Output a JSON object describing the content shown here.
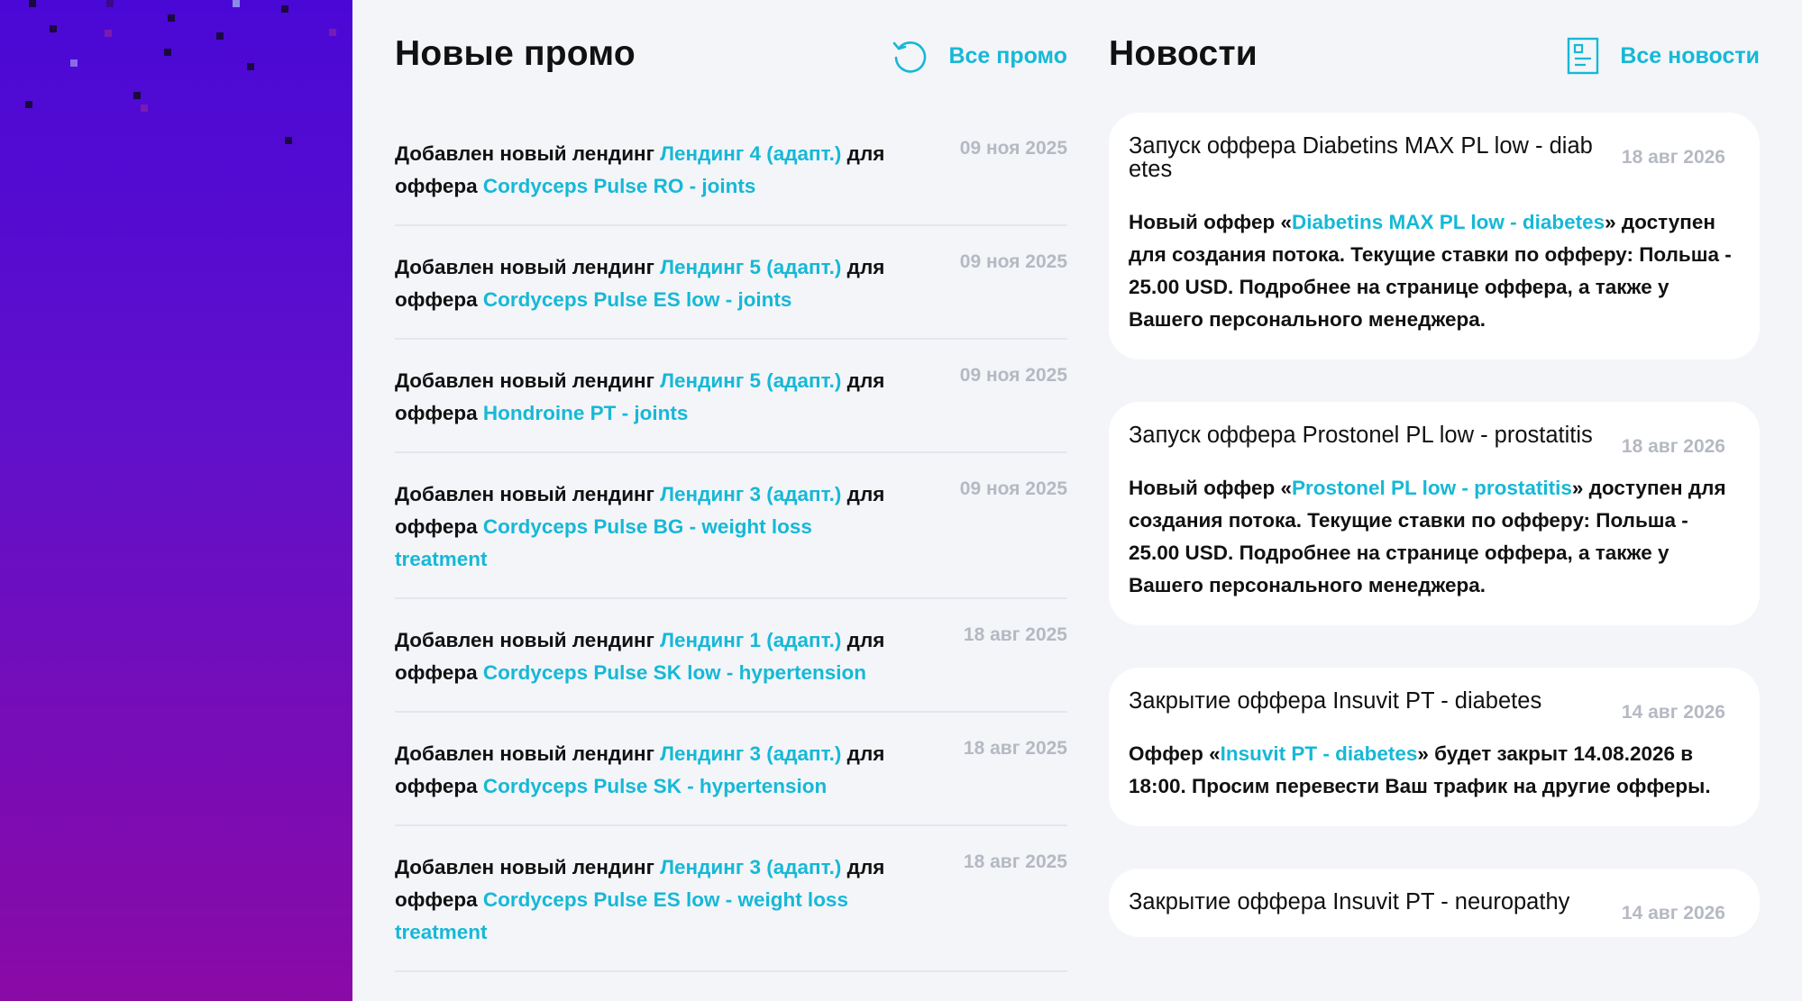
{
  "promo": {
    "title": "Новые промо",
    "all_link": "Все промо",
    "items": [
      {
        "prefix": "Добавлен новый лендинг ",
        "landing": "Лендинг 4 (адапт.)",
        "mid": " для оффера ",
        "offer": "Cordyceps Pulse RO - joints",
        "date": "09 ноя 2025"
      },
      {
        "prefix": "Добавлен новый лендинг ",
        "landing": "Лендинг 5 (адапт.)",
        "mid": " для оффера ",
        "offer": "Cordyceps Pulse ES low - joints",
        "date": "09 ноя 2025"
      },
      {
        "prefix": "Добавлен новый лендинг ",
        "landing": "Лендинг 5 (адапт.)",
        "mid": " для оффера ",
        "offer": "Hondroine PT - joints",
        "date": "09 ноя 2025"
      },
      {
        "prefix": "Добавлен новый лендинг ",
        "landing": "Лендинг 3 (адапт.)",
        "mid": " для оффера ",
        "offer": "Cordyceps Pulse BG - weight loss treatment",
        "date": "09 ноя 2025"
      },
      {
        "prefix": "Добавлен новый лендинг ",
        "landing": "Лендинг 1 (адапт.)",
        "mid": " для оффера ",
        "offer": "Cordyceps Pulse SK low - hypertension",
        "date": "18 авг 2025"
      },
      {
        "prefix": "Добавлен новый лендинг ",
        "landing": "Лендинг 3 (адапт.)",
        "mid": " для оффера ",
        "offer": "Cordyceps Pulse SK - hypertension",
        "date": "18 авг 2025"
      },
      {
        "prefix": "Добавлен новый лендинг ",
        "landing": "Лендинг 3 (адапт.)",
        "mid": " для оффера ",
        "offer": "Cordyceps Pulse ES low - weight loss treatment",
        "date": "18 авг 2025"
      }
    ]
  },
  "news": {
    "title": "Новости",
    "all_link": "Все новости",
    "items": [
      {
        "title": "Запуск оффера Diabetins MAX PL low - diabetes",
        "date": "18 авг 2026",
        "body_pre": "Новый оффер «",
        "body_link": "Diabetins MAX PL low - diabetes",
        "body_post": "» доступен для создания потока. Текущие ставки по офферу: Польша - 25.00 USD. Подробнее на странице оффера, а также у Вашего персонального менеджера."
      },
      {
        "title": "Запуск оффера Prostonel PL low - prostatitis",
        "date": "18 авг 2026",
        "body_pre": "Новый оффер «",
        "body_link": "Prostonel PL low - prostatitis",
        "body_post": "» доступен для создания потока. Текущие ставки по офферу: Польша - 25.00 USD. Подробнее на странице оффера, а также у Вашего персонального менеджера."
      },
      {
        "title": "Закрытие оффера Insuvit PT - diabetes",
        "date": "14 авг 2026",
        "body_pre": "Оффер «",
        "body_link": "Insuvit PT - diabetes",
        "body_post": "» будет закрыт 14.08.2026 в 18:00. Просим перевести Ваш трафик на другие офферы."
      },
      {
        "title": "Закрытие оффера Insuvit PT - neuropathy",
        "date": "14 авг 2026",
        "body_pre": "",
        "body_link": "",
        "body_post": ""
      }
    ]
  },
  "colors": {
    "accent": "#16b8d6",
    "sidebar_top": "#4a08d6",
    "sidebar_bottom": "#8a0aa6"
  },
  "icons": {
    "promo_link_icon": "refresh-icon",
    "news_link_icon": "document-icon"
  }
}
